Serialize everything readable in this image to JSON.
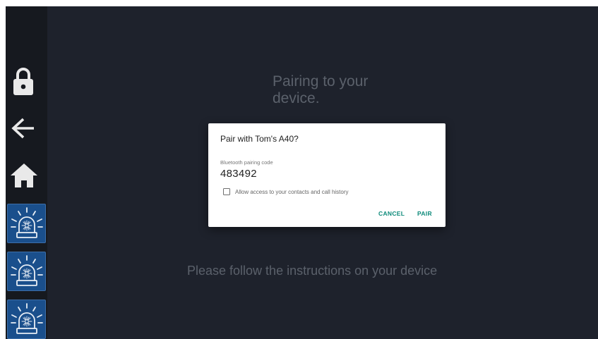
{
  "screen": {
    "headline": "Pairing to your device.",
    "instruction": "Please follow the instructions on your device"
  },
  "sidebar": {
    "icons": [
      "lock-icon",
      "back-arrow-icon",
      "home-icon",
      "alarm-siren-icon",
      "alarm-siren-icon",
      "alarm-siren-icon"
    ]
  },
  "dialog": {
    "title": "Pair with Tom's A40?",
    "code_label": "Bluetooth pairing code",
    "code": "483492",
    "checkbox_label": "Allow access to your contacts and call history",
    "checkbox_checked": false,
    "cancel_label": "CANCEL",
    "pair_label": "PAIR"
  },
  "colors": {
    "background": "#1e222c",
    "sidebar": "#16191f",
    "alarm_button": "#1a4f8c",
    "accent": "#0d8a7a"
  }
}
